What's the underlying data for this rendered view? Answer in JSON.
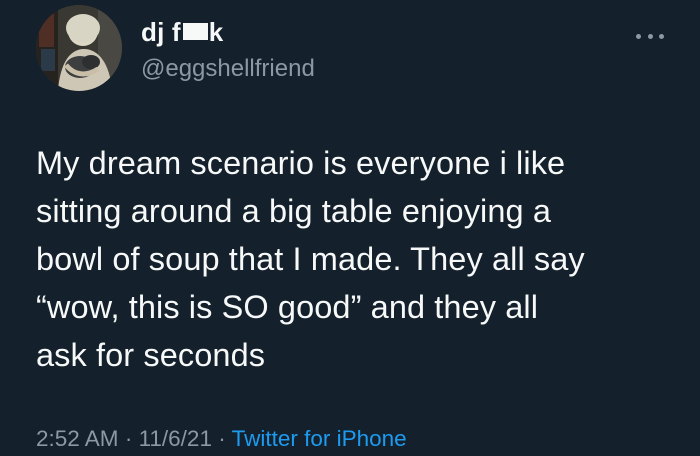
{
  "author": {
    "display_name_prefix": "dj f",
    "display_name_suffix": "k",
    "handle": "@eggshellfriend"
  },
  "tweet": {
    "lines": [
      "My dream scenario is everyone i like",
      "sitting around a big table enjoying a",
      "bowl of soup that I made. They all say",
      "“wow, this is SO good” and they all",
      "ask for seconds"
    ]
  },
  "meta": {
    "time": "2:52 AM",
    "separator": " · ",
    "date": "11/6/21",
    "source": "Twitter for iPhone"
  },
  "icons": {
    "more": "more-horizontal-icon",
    "avatar": "profile-photo"
  },
  "colors": {
    "background": "#15202b",
    "text": "#f7f9f9",
    "secondary": "#8b98a5",
    "link": "#1d9bf0"
  }
}
